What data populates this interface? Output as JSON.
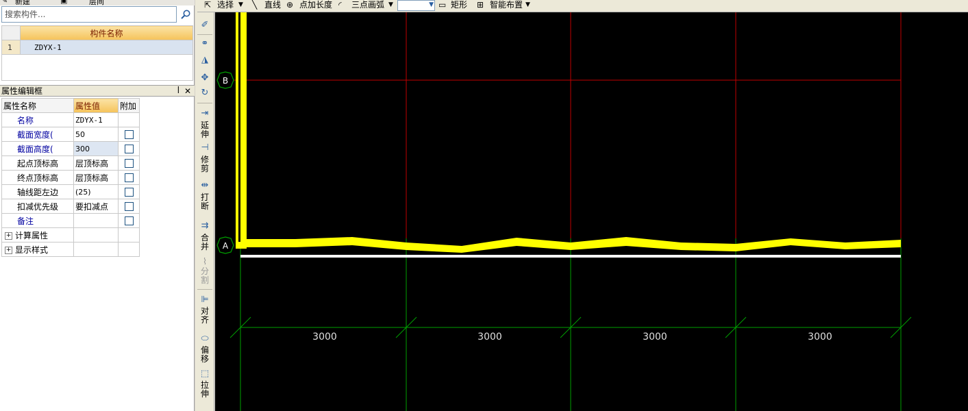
{
  "colors": {
    "canvas_bg": "#000000",
    "wall_yellow": "#ffff00",
    "red_grid": "#c00000",
    "green_grid": "#00a000",
    "header_orange": "#f5c35a"
  },
  "top_strip": {
    "new_label": "新建",
    "layer_label": "层间"
  },
  "search": {
    "placeholder": "搜索构件...",
    "icon": "search-icon"
  },
  "component_list": {
    "header": "构件名称",
    "rows": [
      {
        "index": "1",
        "name": "ZDYX-1"
      }
    ]
  },
  "properties_panel": {
    "title": "属性编辑框",
    "pin_icon": "pin-icon",
    "close_icon": "close-icon",
    "columns": [
      "属性名称",
      "属性值",
      "附加"
    ],
    "rows": [
      {
        "name": "名称",
        "value": "ZDYX-1",
        "blue": true,
        "checkbox": false
      },
      {
        "name": "截面宽度(",
        "value": "50",
        "blue": true,
        "checkbox": true
      },
      {
        "name": "截面高度(",
        "value": "300",
        "blue": true,
        "checkbox": true
      },
      {
        "name": "起点顶标高",
        "value": "层顶标高",
        "blue": false,
        "checkbox": true
      },
      {
        "name": "终点顶标高",
        "value": "层顶标高",
        "blue": false,
        "checkbox": true
      },
      {
        "name": "轴线距左边",
        "value": "(25)",
        "blue": false,
        "checkbox": true
      },
      {
        "name": "扣减优先级",
        "value": "要扣减点",
        "blue": false,
        "checkbox": true
      },
      {
        "name": "备注",
        "value": "",
        "blue": true,
        "checkbox": true
      }
    ],
    "groups": [
      "计算属性",
      "显示样式"
    ]
  },
  "top_toolbar": {
    "select": "选择",
    "line": "直线",
    "point_length": "点加长度",
    "arc": "三点画弧",
    "rect": "矩形",
    "smart_layout": "智能布置"
  },
  "vertical_toolbar": {
    "extend": "延伸",
    "trim": "修剪",
    "break": "打断",
    "merge": "合并",
    "split": "分割",
    "align": "对齐",
    "offset": "偏移",
    "stretch": "拉伸"
  },
  "drawing": {
    "axis_labels": [
      "B",
      "A"
    ],
    "dimensions": [
      "3000",
      "3000",
      "3000",
      "3000"
    ]
  }
}
